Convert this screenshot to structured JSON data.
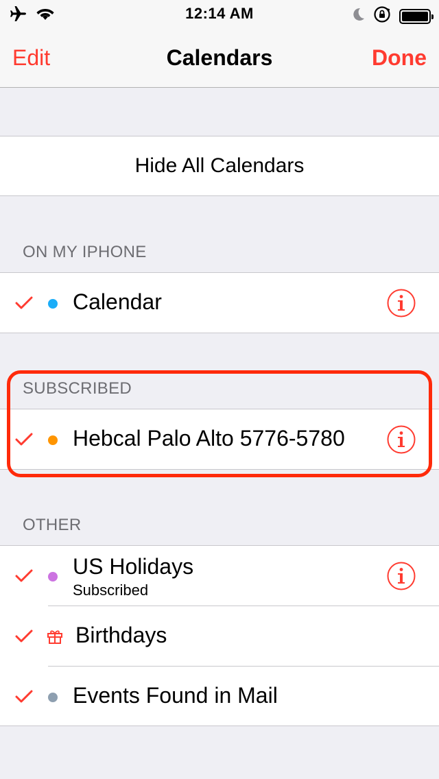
{
  "status_bar": {
    "time": "12:14 AM",
    "icons": [
      "airplane-icon",
      "wifi-icon",
      "moon-icon",
      "rotation-lock-icon",
      "battery-icon"
    ]
  },
  "nav": {
    "edit_label": "Edit",
    "title": "Calendars",
    "done_label": "Done"
  },
  "hide_all_label": "Hide All Calendars",
  "sections": {
    "on_my_iphone": {
      "header": "ON MY IPHONE",
      "items": [
        {
          "title": "Calendar",
          "checked": true,
          "color": "#1badf8"
        }
      ]
    },
    "subscribed": {
      "header": "SUBSCRIBED",
      "items": [
        {
          "title": "Hebcal Palo Alto 5776-5780",
          "checked": true,
          "color": "#ff9500"
        }
      ]
    },
    "other": {
      "header": "OTHER",
      "items": [
        {
          "title": "US Holidays",
          "subtitle": "Subscribed",
          "checked": true,
          "color": "#cc73e1"
        },
        {
          "title": "Birthdays",
          "checked": true,
          "icon": "gift-icon"
        },
        {
          "title": "Events Found in Mail",
          "checked": true,
          "color": "#8e9fb0"
        }
      ]
    }
  },
  "colors": {
    "accent": "#ff3b30",
    "highlight": "#ff2a0a",
    "background": "#efeff4"
  }
}
